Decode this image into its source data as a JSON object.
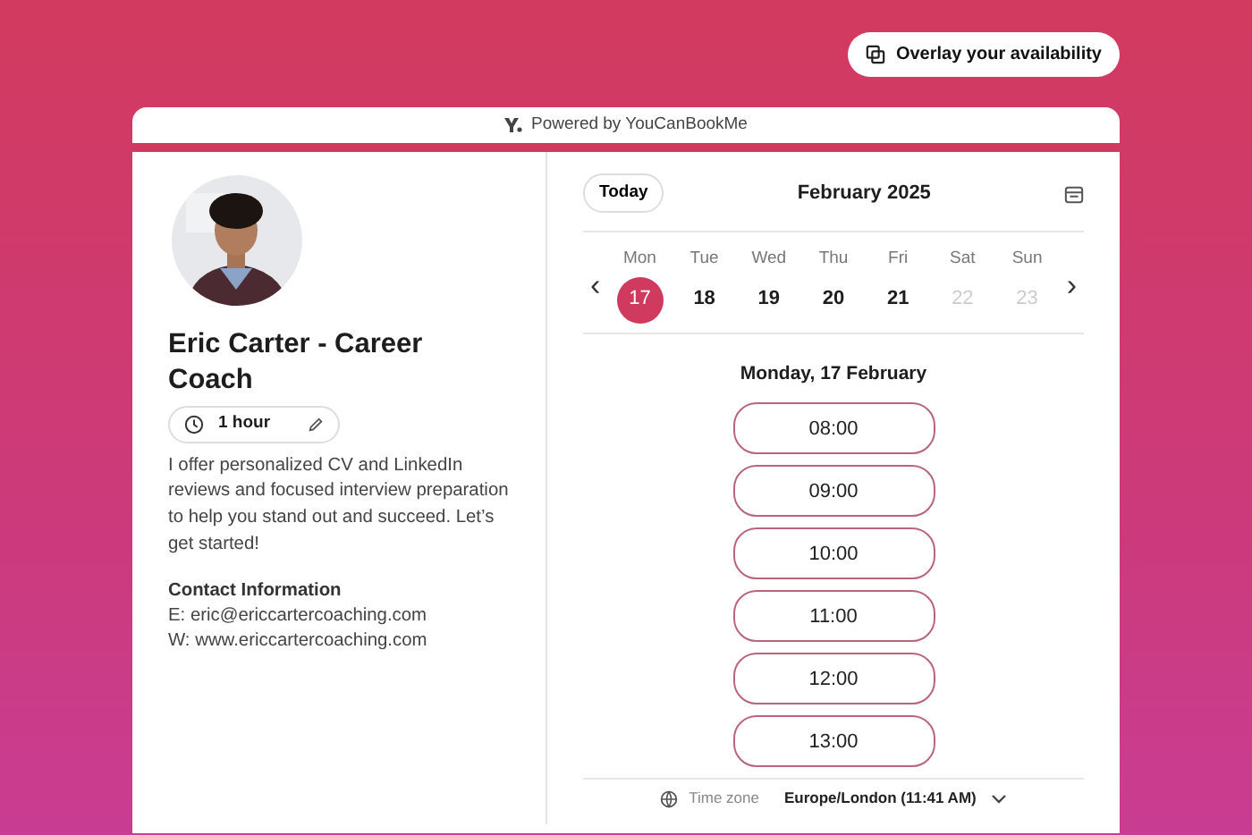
{
  "overlay_button": {
    "label": "Overlay your availability"
  },
  "powered_by": "Powered by YouCanBookMe",
  "profile": {
    "name": "Eric Carter - Career Coach",
    "duration": "1 hour",
    "description": "I offer personalized CV and LinkedIn reviews and focused interview preparation to help you stand out and succeed. Let’s get started!",
    "contact_heading": "Contact Information",
    "contact_lines": [
      "E: eric@ericcartercoaching.com",
      "W: www.ericcartercoaching.com"
    ]
  },
  "calendar": {
    "today_button": "Today",
    "month": "February 2025",
    "prev": "‹",
    "next": "›",
    "days": [
      {
        "weekday": "Mon",
        "date": "17",
        "selected": true,
        "disabled": false
      },
      {
        "weekday": "Tue",
        "date": "18",
        "selected": false,
        "disabled": false
      },
      {
        "weekday": "Wed",
        "date": "19",
        "selected": false,
        "disabled": false
      },
      {
        "weekday": "Thu",
        "date": "20",
        "selected": false,
        "disabled": false
      },
      {
        "weekday": "Fri",
        "date": "21",
        "selected": false,
        "disabled": false
      },
      {
        "weekday": "Sat",
        "date": "22",
        "selected": false,
        "disabled": true
      },
      {
        "weekday": "Sun",
        "date": "23",
        "selected": false,
        "disabled": true
      }
    ],
    "selected_heading": "Monday, 17 February",
    "slots": [
      "08:00",
      "09:00",
      "10:00",
      "11:00",
      "12:00",
      "13:00"
    ],
    "timezone_label": "Time zone",
    "timezone_value": "Europe/London (11:41 AM)"
  }
}
